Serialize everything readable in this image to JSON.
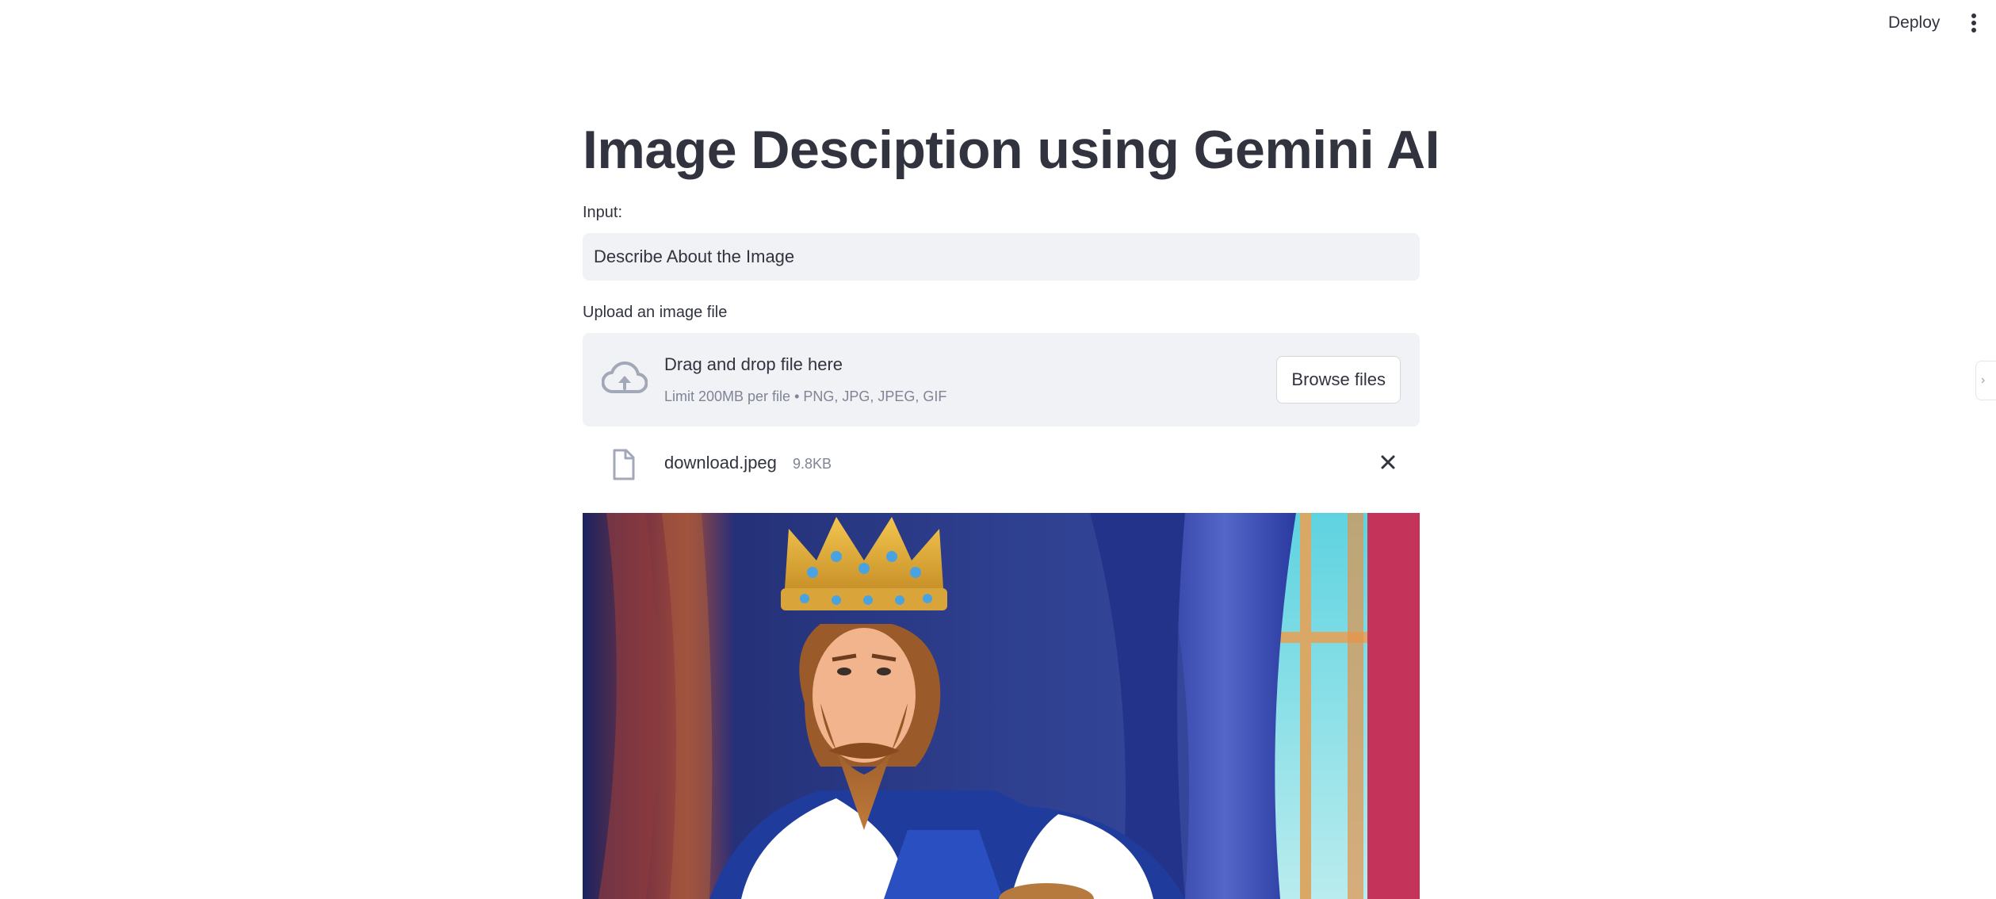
{
  "header": {
    "deploy_label": "Deploy",
    "menu_icon": "vertical-ellipsis-icon"
  },
  "main": {
    "title": "Image Desciption using Gemini AI",
    "input": {
      "label": "Input:",
      "value": "Describe About the Image"
    },
    "uploader": {
      "label": "Upload an image file",
      "drop_text": "Drag and drop file here",
      "limit_text": "Limit 200MB per file • PNG, JPG, JPEG, GIF",
      "browse_label": "Browse files",
      "icon": "cloud-upload-icon"
    },
    "uploaded_file": {
      "name": "download.jpeg",
      "size": "9.8KB",
      "icon": "file-icon",
      "remove_icon": "close-icon"
    }
  },
  "colors": {
    "text": "#31333f",
    "muted": "#808495",
    "field_bg": "#f0f2f6",
    "icon": "#a3a8b8"
  }
}
